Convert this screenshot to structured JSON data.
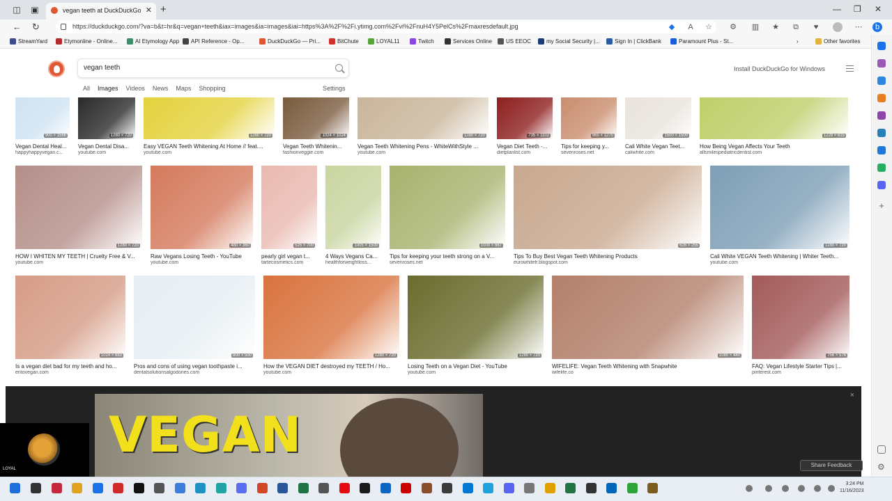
{
  "browser": {
    "tab_title": "vegan teeth at DuckDuckGo",
    "url": "https://duckduckgo.com/?va=b&t=hr&q=vegan+teeth&iax=images&ia=images&iai=https%3A%2F%2Fi.ytimg.com%2Fvi%2FnuH4Y5PelCs%2Fmaxresdefault.jpg"
  },
  "bookmarks": [
    {
      "label": "StreamYard",
      "color": "#3b4b8c"
    },
    {
      "label": "Etymonline - Online...",
      "color": "#b52a2a"
    },
    {
      "label": "AI Etymology App",
      "color": "#3e8e6a"
    },
    {
      "label": "API Reference - Op...",
      "color": "#444444"
    },
    {
      "label": "DuckDuckGo — Pri...",
      "color": "#de5833"
    },
    {
      "label": "BitChute",
      "color": "#d0312d"
    },
    {
      "label": "LOYAL11",
      "color": "#56a53a"
    },
    {
      "label": "Twitch",
      "color": "#8a44e0"
    },
    {
      "label": "Services Online",
      "color": "#333333"
    },
    {
      "label": "US EEOC",
      "color": "#555555"
    },
    {
      "label": "my Social Security |...",
      "color": "#1f3b73"
    },
    {
      "label": "Sign In | ClickBank",
      "color": "#2c5aa0"
    },
    {
      "label": "Paramount Plus - St...",
      "color": "#1a5ed8"
    }
  ],
  "other_favorites": "Other favorites",
  "page": {
    "search_query": "vegan teeth",
    "install_link": "Install DuckDuckGo for Windows",
    "filters": [
      "All",
      "Images",
      "Videos",
      "News",
      "Maps",
      "Shopping"
    ],
    "active_filter": "Images",
    "settings": "Settings"
  },
  "rows": [
    [
      {
        "title": "Vegan Dental Heal...",
        "source": "happyhappyvegan.c...",
        "dims": "900 × 1566",
        "color": "#cfe3f2"
      },
      {
        "title": "Vegan Dental Disa...",
        "source": "youtube.com",
        "dims": "1280 × 720",
        "color": "#2a2a2a"
      },
      {
        "title": "Easy VEGAN Teeth Whitening At Home // feat....",
        "source": "youtube.com",
        "dims": "1280 × 720",
        "color": "#e4d23e"
      },
      {
        "title": "Vegan Teeth Whitenin...",
        "source": "fashionveggie.com",
        "dims": "1024 × 1024",
        "color": "#7a5b3d"
      },
      {
        "title": "Vegan Teeth Whitening Pens - WhiteWithStyle ...",
        "source": "youtube.com",
        "dims": "1280 × 720",
        "color": "#c9b59a"
      },
      {
        "title": "Vegan Diet Teeth -...",
        "source": "dietplanlist.com",
        "dims": "735 × 1102",
        "color": "#8e1f1f"
      },
      {
        "title": "Tips for keeping y...",
        "source": "sevenroses.net",
        "dims": "965 × 1270",
        "color": "#c98d6e"
      },
      {
        "title": "Cali White Vegan Teet...",
        "source": "caliwhite.com",
        "dims": "1500 × 1500",
        "color": "#e9e3dc"
      },
      {
        "title": "How Being Vegan Affects Your Teeth",
        "source": "allsmilespediatricdentist.com",
        "dims": "1229 × 615",
        "color": "#bfcf6a"
      }
    ],
    [
      {
        "title": "HOW I WHITEN MY TEETH | Cruelty Free & V...",
        "source": "youtube.com",
        "dims": "1280 × 720",
        "color": "#b58f8a"
      },
      {
        "title": "Raw Vegans Losing Teeth - YouTube",
        "source": "youtube.com",
        "dims": "480 × 360",
        "color": "#d47a5c"
      },
      {
        "title": "pearly girl vegan t...",
        "source": "tartecosmetics.com",
        "dims": "525 × 700",
        "color": "#e9b9b0"
      },
      {
        "title": "4 Ways Vegans Ca...",
        "source": "healthforweightloss...",
        "dims": "1005 × 1500",
        "color": "#c9d5a0"
      },
      {
        "title": "Tips for keeping your teeth strong on a V...",
        "source": "sevenroses.net",
        "dims": "1000 × 667",
        "color": "#a7b36e"
      },
      {
        "title": "Tips To Buy Best Vegan Teeth Whitening Products",
        "source": "eurowhitefr.blogspot.com",
        "dims": "626 × 255",
        "color": "#c9a88e"
      },
      {
        "title": "Cali White VEGAN Teeth Whitening | Whiter Teeth...",
        "source": "youtube.com",
        "dims": "1280 × 720",
        "color": "#7e9fb7"
      }
    ],
    [
      {
        "title": "Is a vegan diet bad for my teeth and ho...",
        "source": "entovegan.com",
        "dims": "1024 × 683",
        "color": "#d69c86"
      },
      {
        "title": "Pros and cons of using vegan toothpaste i...",
        "source": "dentalsolutionsalgodones.com",
        "dims": "800 × 500",
        "color": "#e6eef2"
      },
      {
        "title": "How the VEGAN DIET destroyed my TEETH / Ho...",
        "source": "youtube.com",
        "dims": "1280 × 720",
        "color": "#d9733e"
      },
      {
        "title": "Losing Teeth on a Vegan Diet - YouTube",
        "source": "youtube.com",
        "dims": "1280 × 720",
        "color": "#6a6d2e"
      },
      {
        "title": "WIFELIFE: Vegan Teeth Whitening with Snapwhite",
        "source": "wifelife.co",
        "dims": "1080 × 440",
        "color": "#b3806b"
      },
      {
        "title": "FAQ: Vegan Lifestyle Starter Tips |...",
        "source": "pinterest.com",
        "dims": "756 × 576",
        "color": "#a35a5a"
      }
    ]
  ],
  "overlay": {
    "headline": "VEGAN",
    "close": "×"
  },
  "feedback": "Share Feedback",
  "webcam_label": "LOYAL",
  "clock": {
    "time": "3:24 PM",
    "date": "11/16/2023"
  },
  "taskbar_icons": [
    "#1e6fd9",
    "#333333",
    "#c4283c",
    "#e1a21f",
    "#1a73e8",
    "#cf2b2b",
    "#111111",
    "#555555",
    "#3d7edb",
    "#1e90c3",
    "#1fa3a3",
    "#5b6df0",
    "#d24726",
    "#2b579a",
    "#217346",
    "#555555",
    "#e50914",
    "#1a1a1a",
    "#0a66c2",
    "#cc0000",
    "#8a4f2a",
    "#3b3b3b",
    "#0078d4",
    "#1fa3dd",
    "#5865f2",
    "#777777",
    "#e0a100",
    "#217346",
    "#333333",
    "#0066b8",
    "#2fa33a",
    "#7a5c1e"
  ]
}
